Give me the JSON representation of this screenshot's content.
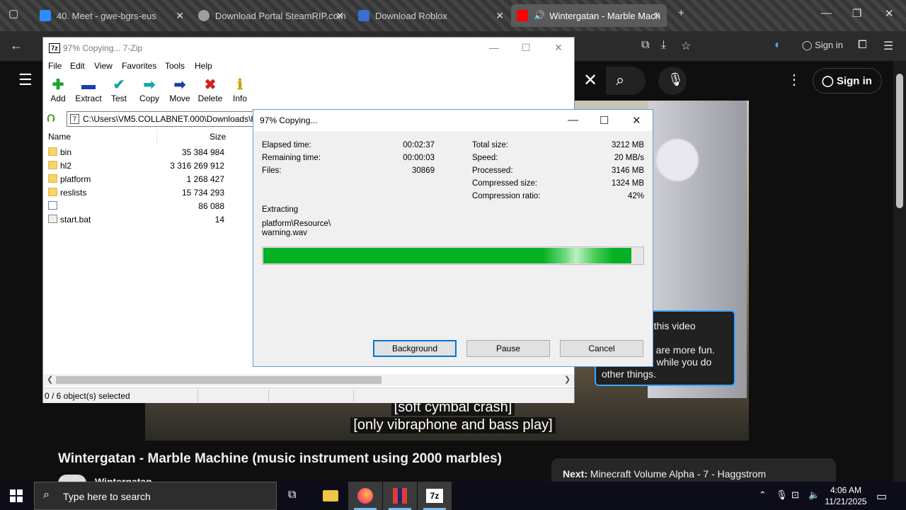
{
  "browser": {
    "tabs": [
      {
        "label": "40. Meet - gwe-bgrs-eus",
        "icon_color": "#2d8cff"
      },
      {
        "label": "Download Portal SteamRIP.com",
        "icon_color": "#9aa0a6"
      },
      {
        "label": "Download Roblox",
        "icon_color": "#3b6fd1"
      },
      {
        "label": "Wintergatan - Marble Mach",
        "icon_color": "#ff0000"
      }
    ],
    "sign_in": "Sign in"
  },
  "youtube": {
    "sign_in": "Sign in",
    "subtitles": [
      "[soft cymbal crash]",
      "[only vibraphone and bass play]"
    ],
    "video_title": "Wintergatan - Marble Machine (music instrument using 2000 marbles)",
    "channel_name": "Wintergatan",
    "next_label": "Next:",
    "next_title": "Minecraft Volume Alpha - 7 - Haggstrom",
    "tooltip_line1": "ut this video",
    "tooltip_line2": "ns are more fun.",
    "tooltip_line3": "eo while you do",
    "tooltip_line4": "other things."
  },
  "sevenzip": {
    "title": "97% Copying... 7-Zip",
    "logo": "7z",
    "menu": [
      "File",
      "Edit",
      "View",
      "Favorites",
      "Tools",
      "Help"
    ],
    "toolbar": [
      {
        "label": "Add",
        "glyph": "✚",
        "color": "#1aa32a"
      },
      {
        "label": "Extract",
        "glyph": "▬",
        "color": "#1a3ea8"
      },
      {
        "label": "Test",
        "glyph": "✔",
        "color": "#18a6a6"
      },
      {
        "label": "Copy",
        "glyph": "➡",
        "color": "#18a6a6"
      },
      {
        "label": "Move",
        "glyph": "➡",
        "color": "#1a3ea8"
      },
      {
        "label": "Delete",
        "glyph": "✖",
        "color": "#d11f1f"
      },
      {
        "label": "Info",
        "glyph": "ℹ",
        "color": "#c8a400"
      }
    ],
    "path": "C:\\Users\\VM5.COLLABNET.000\\Downloads\\H",
    "columns": {
      "name": "Name",
      "size": "Size"
    },
    "files": [
      {
        "name": "bin",
        "size": "35 384 984",
        "type": "folder"
      },
      {
        "name": "hl2",
        "size": "3 316 269 912",
        "type": "folder"
      },
      {
        "name": "platform",
        "size": "1 268 427",
        "type": "folder"
      },
      {
        "name": "reslists",
        "size": "15 734 293",
        "type": "folder"
      },
      {
        "name": "",
        "size": "86 088",
        "type": "file"
      },
      {
        "name": "start.bat",
        "size": "14",
        "type": "bat"
      }
    ],
    "status": "0 / 6 object(s) selected"
  },
  "progress_dialog": {
    "title": "97% Copying...",
    "left_stats": [
      {
        "label": "Elapsed time:",
        "value": "00:02:37"
      },
      {
        "label": "Remaining time:",
        "value": "00:00:03"
      },
      {
        "label": "Files:",
        "value": "30869"
      }
    ],
    "right_stats": [
      {
        "label": "Total size:",
        "value": "3212 MB"
      },
      {
        "label": "Speed:",
        "value": "20 MB/s"
      },
      {
        "label": "Processed:",
        "value": "3146 MB"
      },
      {
        "label": "Compressed size:",
        "value": "1324 MB"
      },
      {
        "label": "Compression ratio:",
        "value": "42%"
      }
    ],
    "action": "Extracting",
    "current_path": "platform\\Resource\\",
    "current_file": "warning.wav",
    "progress_fraction": 0.97,
    "buttons": {
      "background": "Background",
      "pause": "Pause",
      "cancel": "Cancel"
    }
  },
  "taskbar": {
    "search_placeholder": "Type here to search",
    "time": "4:06 AM",
    "date": "11/21/2025",
    "app7z_label": "7z"
  }
}
